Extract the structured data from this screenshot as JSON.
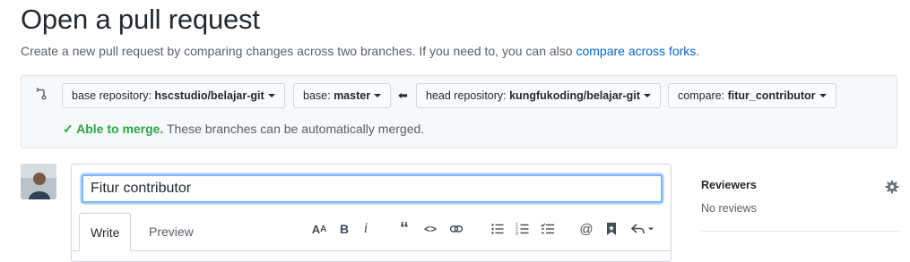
{
  "page": {
    "title": "Open a pull request",
    "subtitle": "Create a new pull request by comparing changes across two branches. If you need to, you can also ",
    "subtitle_link": "compare across forks",
    "subtitle_end": "."
  },
  "range": {
    "base_repo_prefix": "base repository: ",
    "base_repo": "hscstudio/belajar-git",
    "base_prefix": "base: ",
    "base": "master",
    "head_repo_prefix": "head repository: ",
    "head_repo": "kungfukoding/belajar-git",
    "compare_prefix": "compare: ",
    "compare": "fitur_contributor",
    "merge_ok": "Able to merge.",
    "merge_text": " These branches can be automatically merged."
  },
  "form": {
    "title_value": "Fitur contributor",
    "tabs": [
      "Write",
      "Preview"
    ]
  },
  "toolbar": {
    "icons": [
      "text-size-icon",
      "bold-icon",
      "italic-icon",
      "quote-icon",
      "code-icon",
      "link-icon",
      "unordered-list-icon",
      "ordered-list-icon",
      "task-list-icon",
      "mention-icon",
      "bookmark-icon",
      "reply-icon"
    ]
  },
  "sidebar": {
    "reviewers_title": "Reviewers",
    "reviewers_value": "No reviews"
  },
  "colors": {
    "link": "#0366d6",
    "success": "#28a745",
    "focus": "#79b8ff"
  }
}
